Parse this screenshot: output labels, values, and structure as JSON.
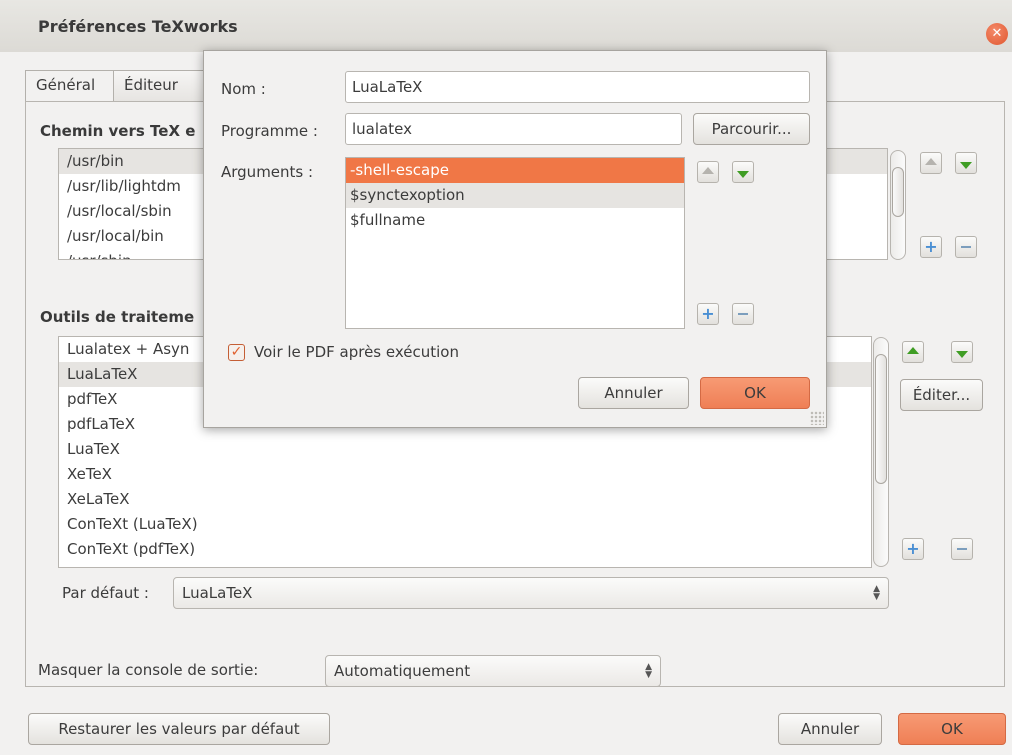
{
  "window": {
    "title": "Préférences TeXworks",
    "close_icon": "close-icon"
  },
  "tabs": [
    "Général",
    "Éditeur"
  ],
  "paths": {
    "title": "Chemin vers TeX e",
    "items": [
      "/usr/bin",
      "/usr/lib/lightdm",
      "/usr/local/sbin",
      "/usr/local/bin",
      "/usr/sbin"
    ]
  },
  "tools": {
    "title": "Outils de traiteme",
    "items": [
      "Lualatex + Asyn",
      "LuaLaTeX",
      "pdfTeX",
      "pdfLaTeX",
      "LuaTeX",
      "XeTeX",
      "XeLaTeX",
      "ConTeXt (LuaTeX)",
      "ConTeXt (pdfTeX)"
    ],
    "selected": "LuaLaTeX",
    "edit_label": "Éditer...",
    "default_label": "Par défaut :",
    "default_value": "LuaLaTeX"
  },
  "console": {
    "label": "Masquer la console de sortie:",
    "value": "Automatiquement"
  },
  "footer": {
    "restore_label": "Restaurer les valeurs par défaut",
    "cancel_label": "Annuler",
    "ok_label": "OK"
  },
  "dialog": {
    "name_label": "Nom :",
    "name_value": "LuaLaTeX",
    "program_label": "Programme :",
    "program_value": "lualatex",
    "browse_label": "Parcourir...",
    "arguments_label": "Arguments :",
    "arguments": [
      "-shell-escape",
      "$synctexoption",
      "$fullname"
    ],
    "selected_argument": "-shell-escape",
    "show_pdf_label": "Voir le PDF après exécution",
    "show_pdf_checked": true,
    "cancel_label": "Annuler",
    "ok_label": "OK"
  },
  "colors": {
    "accent": "#f07746",
    "ok_button": "#ef7f55"
  }
}
